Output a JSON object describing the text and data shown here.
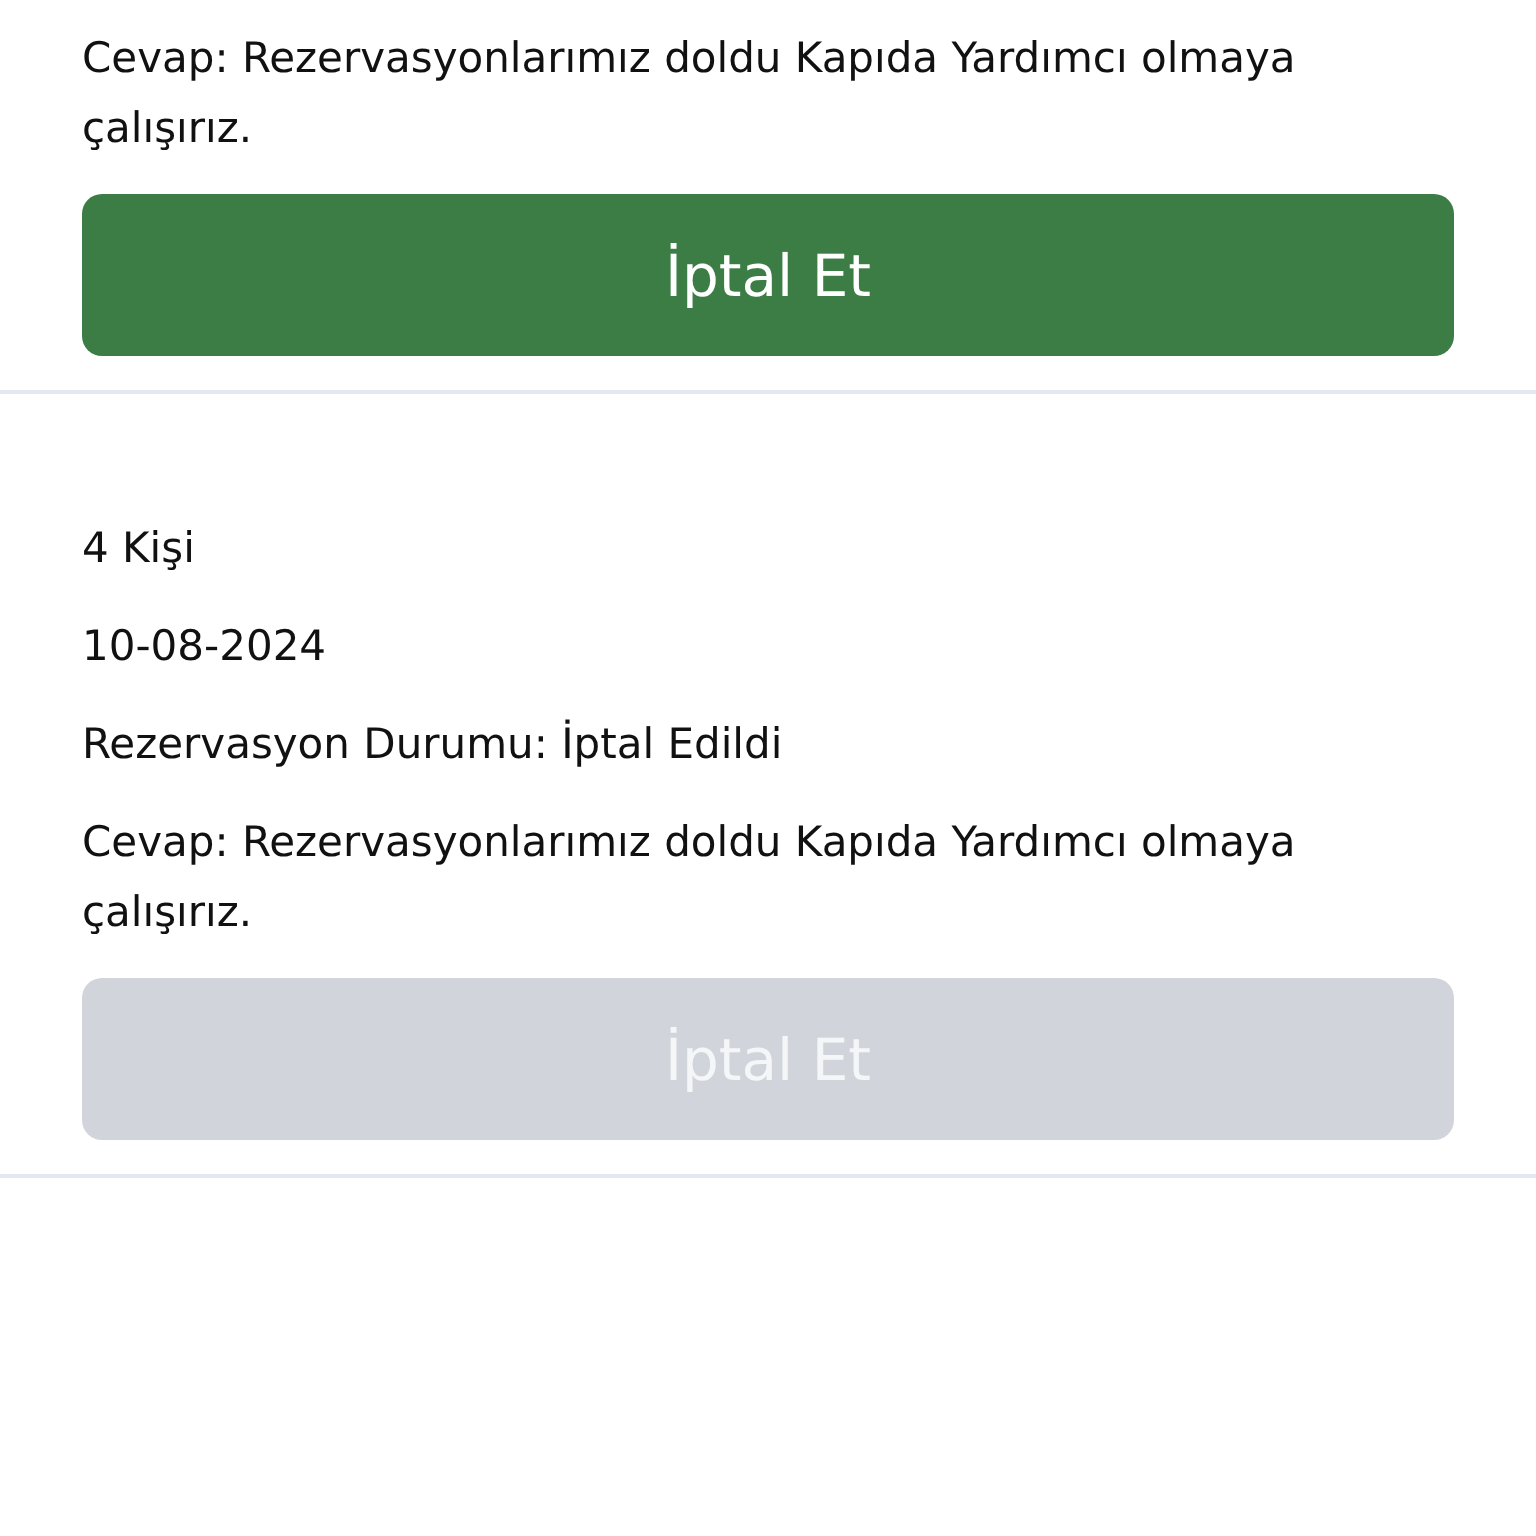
{
  "reservations": [
    {
      "answer": "Cevap: Rezervasyonlarımız doldu Kapıda Yardımcı olmaya çalışırız.",
      "cancel_button": {
        "label": "İptal Et",
        "disabled": false
      }
    },
    {
      "people": "4 Kişi",
      "date": "10-08-2024",
      "status": "Rezervasyon Durumu: İptal Edildi",
      "answer": "Cevap: Rezervasyonlarımız doldu Kapıda Yardımcı olmaya çalışırız.",
      "cancel_button": {
        "label": "İptal Et",
        "disabled": true
      }
    }
  ]
}
